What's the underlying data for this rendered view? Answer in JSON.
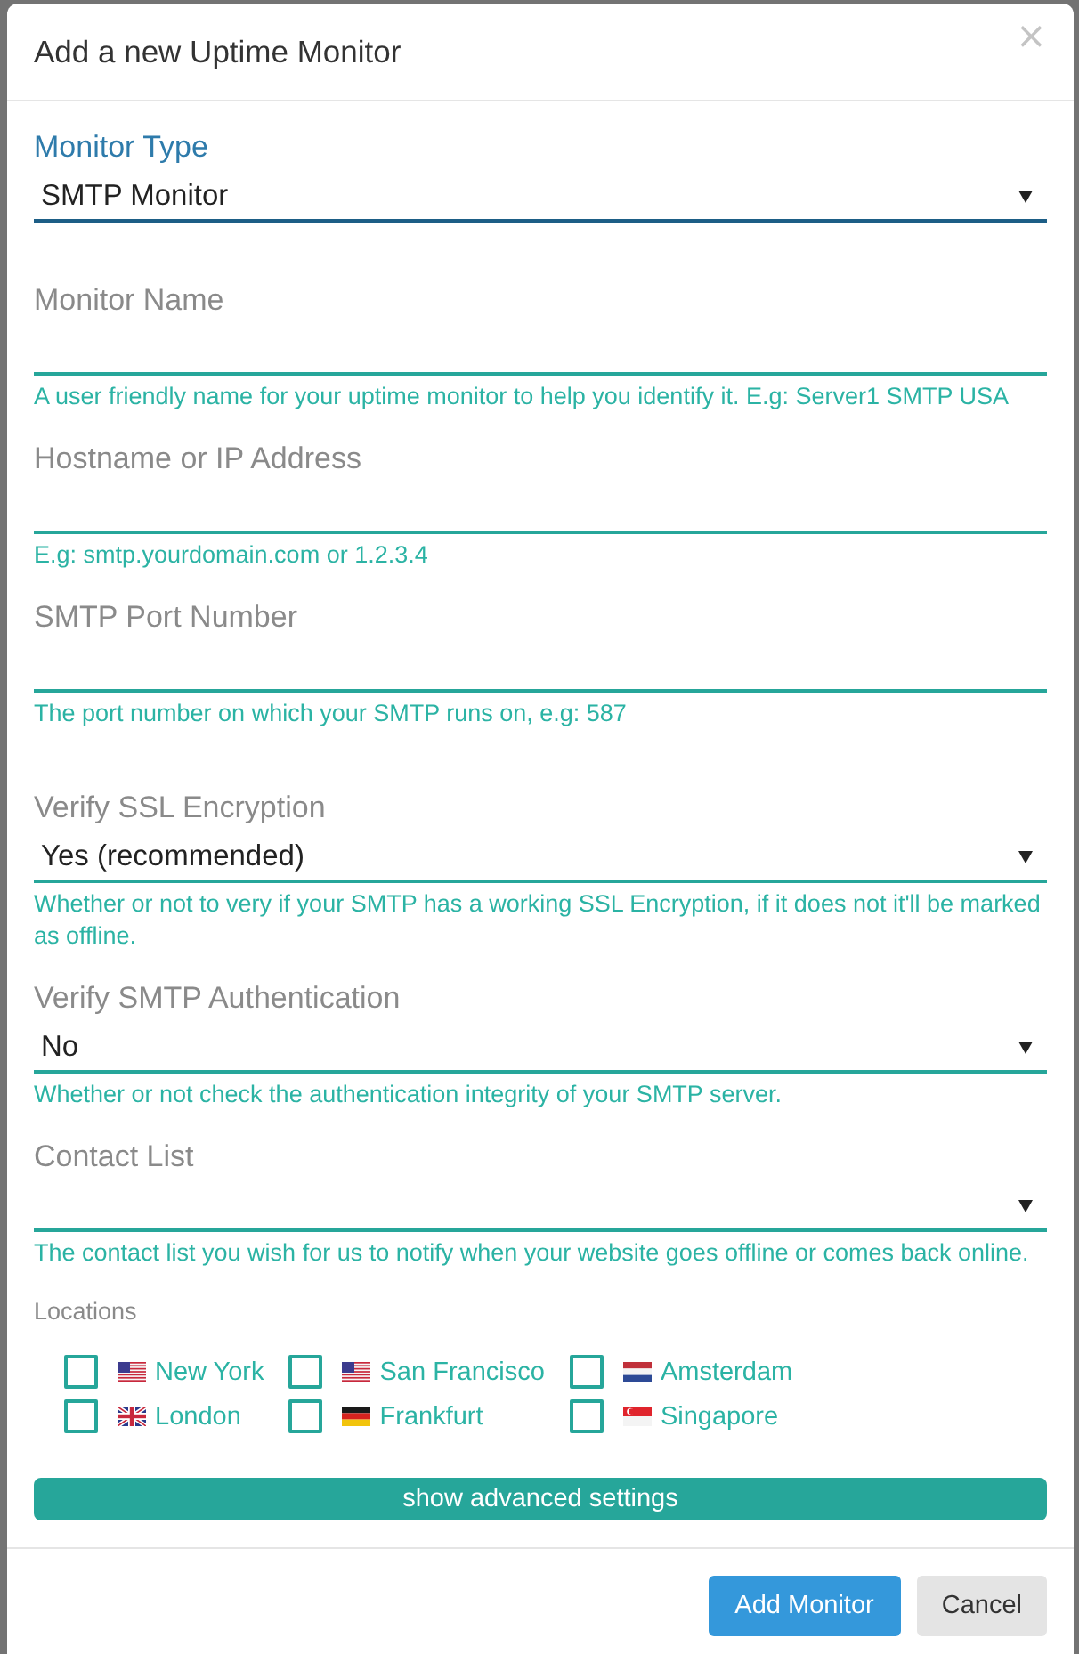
{
  "modal": {
    "title": "Add a new Uptime Monitor",
    "close": "×"
  },
  "sections": [
    {
      "fields": [
        {
          "kind": "select",
          "label": "Monitor Type",
          "value": "SMTP Monitor",
          "focused": true
        }
      ]
    },
    {
      "fields": [
        {
          "kind": "text",
          "label": "Monitor Name",
          "focused": false,
          "help": "A user friendly name for your uptime monitor to help you identify it. E.g: Server1 SMTP USA"
        },
        {
          "kind": "text",
          "label": "Hostname or IP Address",
          "focused": false,
          "help": "E.g: smtp.yourdomain.com or 1.2.3.4"
        },
        {
          "kind": "text",
          "label": "SMTP Port Number",
          "focused": false,
          "help": "The port number on which your SMTP runs on, e.g: 587"
        }
      ]
    },
    {
      "fields": [
        {
          "kind": "select",
          "label": "Verify SSL Encryption",
          "value": "Yes (recommended)",
          "focused": false,
          "help": "Whether or not to very if your SMTP has a working SSL Encryption, if it does not it'll be marked as offline."
        },
        {
          "kind": "select",
          "label": "Verify SMTP Authentication",
          "value": "No",
          "focused": false,
          "help": "Whether or not check the authentication integrity of your SMTP server."
        },
        {
          "kind": "select",
          "label": "Contact List",
          "focused": false,
          "help": "The contact list you wish for us to notify when your website goes offline or comes back online."
        }
      ]
    }
  ],
  "locations": {
    "label": "Locations",
    "items": [
      {
        "name": "New York",
        "kind": "us",
        "checked": false
      },
      {
        "name": "San Francisco",
        "kind": "us",
        "checked": false
      },
      {
        "name": "Amsterdam",
        "kind": "nl",
        "checked": false
      },
      {
        "name": "London",
        "kind": "gb",
        "checked": false
      },
      {
        "name": "Frankfurt",
        "kind": "de",
        "checked": false
      },
      {
        "name": "Singapore",
        "kind": "sg",
        "checked": false
      }
    ]
  },
  "advanced_button": "show advanced settings",
  "buttons": [
    {
      "label": "Add Monitor",
      "kind": "primary"
    },
    {
      "label": "Cancel",
      "kind": "secondary"
    }
  ]
}
